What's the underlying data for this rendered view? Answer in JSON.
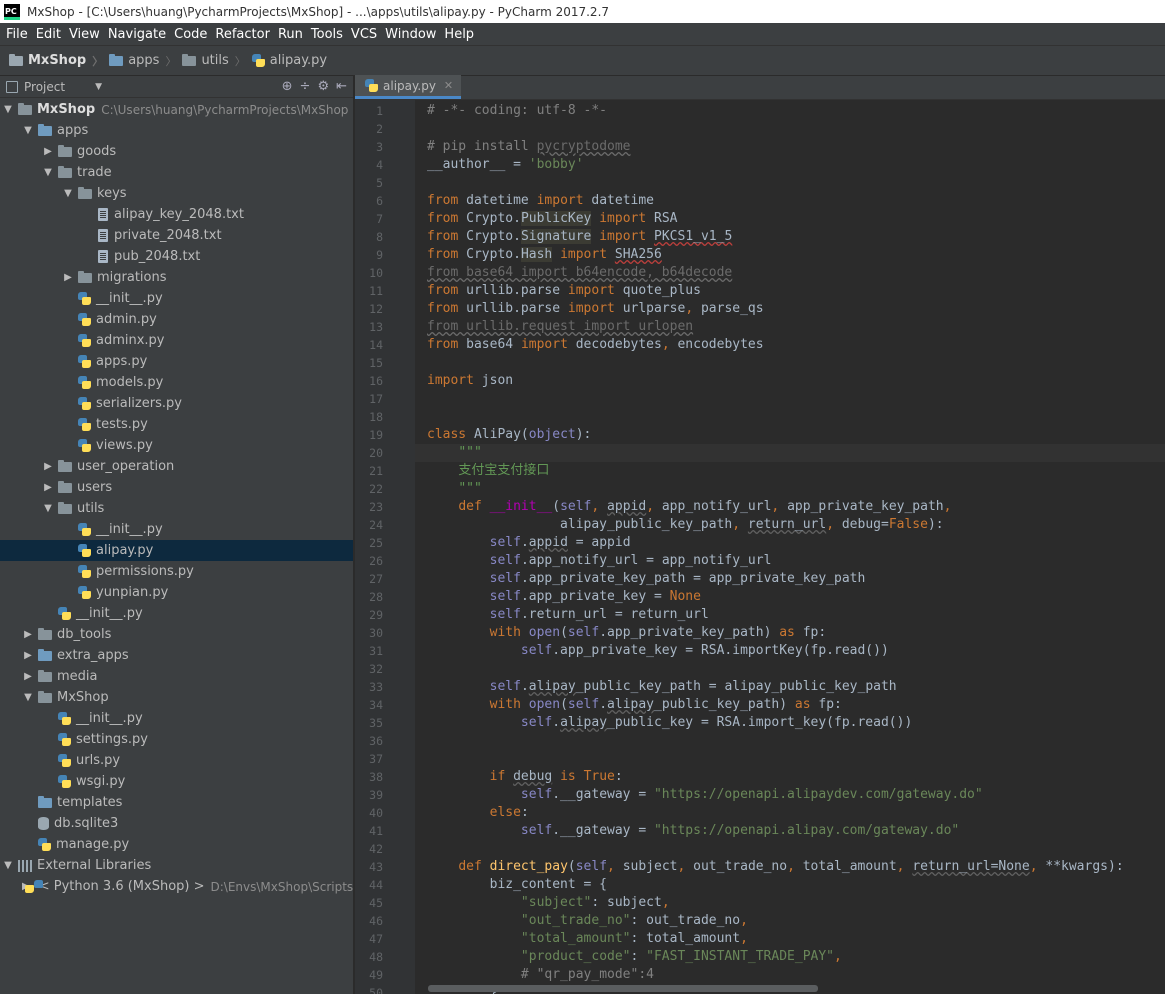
{
  "titlebar": {
    "icon_text": "PC",
    "title": "MxShop - [C:\\Users\\huang\\PycharmProjects\\MxShop] - ...\\apps\\utils\\alipay.py - PyCharm 2017.2.7"
  },
  "menu": [
    "File",
    "Edit",
    "View",
    "Navigate",
    "Code",
    "Refactor",
    "Run",
    "Tools",
    "VCS",
    "Window",
    "Help"
  ],
  "breadcrumb": [
    "MxShop",
    "apps",
    "utils",
    "alipay.py"
  ],
  "project_panel": {
    "label": "Project",
    "tools": [
      "⊕",
      "÷",
      "⚙",
      "⇤"
    ]
  },
  "tree": [
    {
      "label": "MxShop",
      "path": "C:\\Users\\huang\\PycharmProjects\\MxShop",
      "arrow": "▼",
      "icon": "folder",
      "indent": 0,
      "bold": true
    },
    {
      "label": "apps",
      "arrow": "▼",
      "icon": "folder-blue",
      "indent": 1
    },
    {
      "label": "goods",
      "arrow": "▶",
      "icon": "folder",
      "indent": 2
    },
    {
      "label": "trade",
      "arrow": "▼",
      "icon": "folder",
      "indent": 2
    },
    {
      "label": "keys",
      "arrow": "▼",
      "icon": "folder",
      "indent": 3
    },
    {
      "label": "alipay_key_2048.txt",
      "arrow": "",
      "icon": "file",
      "indent": 4
    },
    {
      "label": "private_2048.txt",
      "arrow": "",
      "icon": "file",
      "indent": 4
    },
    {
      "label": "pub_2048.txt",
      "arrow": "",
      "icon": "file",
      "indent": 4
    },
    {
      "label": "migrations",
      "arrow": "▶",
      "icon": "folder",
      "indent": 3
    },
    {
      "label": "__init__.py",
      "arrow": "",
      "icon": "py",
      "indent": 3
    },
    {
      "label": "admin.py",
      "arrow": "",
      "icon": "py",
      "indent": 3
    },
    {
      "label": "adminx.py",
      "arrow": "",
      "icon": "py",
      "indent": 3
    },
    {
      "label": "apps.py",
      "arrow": "",
      "icon": "py",
      "indent": 3
    },
    {
      "label": "models.py",
      "arrow": "",
      "icon": "py",
      "indent": 3
    },
    {
      "label": "serializers.py",
      "arrow": "",
      "icon": "py",
      "indent": 3
    },
    {
      "label": "tests.py",
      "arrow": "",
      "icon": "py",
      "indent": 3
    },
    {
      "label": "views.py",
      "arrow": "",
      "icon": "py",
      "indent": 3
    },
    {
      "label": "user_operation",
      "arrow": "▶",
      "icon": "folder",
      "indent": 2
    },
    {
      "label": "users",
      "arrow": "▶",
      "icon": "folder",
      "indent": 2
    },
    {
      "label": "utils",
      "arrow": "▼",
      "icon": "folder",
      "indent": 2
    },
    {
      "label": "__init__.py",
      "arrow": "",
      "icon": "py",
      "indent": 3
    },
    {
      "label": "alipay.py",
      "arrow": "",
      "icon": "py",
      "indent": 3,
      "selected": true
    },
    {
      "label": "permissions.py",
      "arrow": "",
      "icon": "py",
      "indent": 3
    },
    {
      "label": "yunpian.py",
      "arrow": "",
      "icon": "py",
      "indent": 3
    },
    {
      "label": "__init__.py",
      "arrow": "",
      "icon": "py",
      "indent": 2
    },
    {
      "label": "db_tools",
      "arrow": "▶",
      "icon": "folder",
      "indent": 1
    },
    {
      "label": "extra_apps",
      "arrow": "▶",
      "icon": "folder-blue",
      "indent": 1
    },
    {
      "label": "media",
      "arrow": "▶",
      "icon": "folder",
      "indent": 1
    },
    {
      "label": "MxShop",
      "arrow": "▼",
      "icon": "folder",
      "indent": 1
    },
    {
      "label": "__init__.py",
      "arrow": "",
      "icon": "py",
      "indent": 2
    },
    {
      "label": "settings.py",
      "arrow": "",
      "icon": "py",
      "indent": 2
    },
    {
      "label": "urls.py",
      "arrow": "",
      "icon": "py",
      "indent": 2
    },
    {
      "label": "wsgi.py",
      "arrow": "",
      "icon": "py",
      "indent": 2
    },
    {
      "label": "templates",
      "arrow": "",
      "icon": "folder-blue",
      "indent": 1
    },
    {
      "label": "db.sqlite3",
      "arrow": "",
      "icon": "db",
      "indent": 1
    },
    {
      "label": "manage.py",
      "arrow": "",
      "icon": "py",
      "indent": 1
    },
    {
      "label": "External Libraries",
      "arrow": "▼",
      "icon": "lib",
      "indent": 0
    },
    {
      "label": "< Python 3.6 (MxShop) >",
      "path": "D:\\Envs\\MxShop\\Scripts",
      "arrow": "▶",
      "icon": "py",
      "indent": 1
    }
  ],
  "editor": {
    "tab": "alipay.py",
    "tab_close": "✕",
    "current_line": 20,
    "lines": [
      [
        [
          "cm",
          "# -*- coding: utf-8 -*-"
        ]
      ],
      [],
      [
        [
          "cm",
          "# pip install "
        ],
        [
          "gr",
          "pycryptodome"
        ]
      ],
      [
        [
          "",
          "__author__ = "
        ],
        [
          "st",
          "'bobby'"
        ]
      ],
      [],
      [
        [
          "kw",
          "from "
        ],
        [
          "",
          "datetime "
        ],
        [
          "kw",
          "import "
        ],
        [
          "",
          "datetime"
        ]
      ],
      [
        [
          "kw",
          "from "
        ],
        [
          "",
          "Crypto."
        ],
        [
          "hl",
          "PublicKey"
        ],
        [
          "kw",
          " import "
        ],
        [
          "",
          "RSA"
        ]
      ],
      [
        [
          "kw",
          "from "
        ],
        [
          "",
          "Crypto."
        ],
        [
          "hl",
          "Signature"
        ],
        [
          "kw",
          " import "
        ],
        [
          "ur",
          "PKCS1_v1_5"
        ]
      ],
      [
        [
          "kw",
          "from "
        ],
        [
          "",
          "Crypto."
        ],
        [
          "hl",
          "Hash"
        ],
        [
          "kw",
          " import "
        ],
        [
          "ur",
          "SHA256"
        ]
      ],
      [
        [
          "gr",
          "from base64 import b64encode, b64decode"
        ]
      ],
      [
        [
          "kw",
          "from "
        ],
        [
          "",
          "urllib.parse "
        ],
        [
          "kw",
          "import "
        ],
        [
          "",
          "quote_plus"
        ]
      ],
      [
        [
          "kw",
          "from "
        ],
        [
          "",
          "urllib.parse "
        ],
        [
          "kw",
          "import "
        ],
        [
          "",
          "urlparse"
        ],
        [
          "kw",
          ", "
        ],
        [
          "",
          "parse_qs"
        ]
      ],
      [
        [
          "gr",
          "from urllib.request import urlopen"
        ]
      ],
      [
        [
          "kw",
          "from "
        ],
        [
          "",
          "base64 "
        ],
        [
          "kw",
          "import "
        ],
        [
          "",
          "decodebytes"
        ],
        [
          "kw",
          ", "
        ],
        [
          "",
          "encodebytes"
        ]
      ],
      [],
      [
        [
          "kw",
          "import "
        ],
        [
          "",
          "json"
        ]
      ],
      [],
      [],
      [
        [
          "kw",
          "class "
        ],
        [
          "",
          "AliPay("
        ],
        [
          "bi",
          "object"
        ],
        [
          "",
          "):"
        ]
      ],
      [
        [
          "",
          "    "
        ],
        [
          "cn",
          "\"\"\""
        ]
      ],
      [
        [
          "",
          "    "
        ],
        [
          "cn",
          "支付宝支付接口"
        ]
      ],
      [
        [
          "",
          "    "
        ],
        [
          "cn",
          "\"\"\""
        ]
      ],
      [
        [
          "",
          "    "
        ],
        [
          "kw",
          "def "
        ],
        [
          "dn",
          "__init__"
        ],
        [
          "",
          "("
        ],
        [
          "sf",
          "self"
        ],
        [
          "kw",
          ", "
        ],
        [
          "un",
          "appid"
        ],
        [
          "kw",
          ", "
        ],
        [
          "",
          "app_notify_url"
        ],
        [
          "kw",
          ", "
        ],
        [
          "",
          "app_private_key_path"
        ],
        [
          "kw",
          ","
        ]
      ],
      [
        [
          "",
          "                 alipay_public_key_path"
        ],
        [
          "kw",
          ", "
        ],
        [
          "un",
          "return_url"
        ],
        [
          "kw",
          ", "
        ],
        [
          "",
          "debug="
        ],
        [
          "kw",
          "False"
        ],
        [
          "",
          "):"
        ]
      ],
      [
        [
          "",
          "        "
        ],
        [
          "sf",
          "self"
        ],
        [
          "",
          "."
        ],
        [
          "un",
          "appid"
        ],
        [
          "",
          " = appid"
        ]
      ],
      [
        [
          "",
          "        "
        ],
        [
          "sf",
          "self"
        ],
        [
          "",
          ".app_notify_url = app_notify_url"
        ]
      ],
      [
        [
          "",
          "        "
        ],
        [
          "sf",
          "self"
        ],
        [
          "",
          ".app_private_key_path = app_private_key_path"
        ]
      ],
      [
        [
          "",
          "        "
        ],
        [
          "sf",
          "self"
        ],
        [
          "",
          ".app_private_key = "
        ],
        [
          "kw",
          "None"
        ]
      ],
      [
        [
          "",
          "        "
        ],
        [
          "sf",
          "self"
        ],
        [
          "",
          ".return_url = return_url"
        ]
      ],
      [
        [
          "",
          "        "
        ],
        [
          "kw",
          "with "
        ],
        [
          "bi",
          "open"
        ],
        [
          "",
          "("
        ],
        [
          "sf",
          "self"
        ],
        [
          "",
          ".app_private_key_path) "
        ],
        [
          "kw",
          "as "
        ],
        [
          "",
          "fp:"
        ]
      ],
      [
        [
          "",
          "            "
        ],
        [
          "sf",
          "self"
        ],
        [
          "",
          ".app_private_key = RSA.importKey(fp.read())"
        ]
      ],
      [],
      [
        [
          "",
          "        "
        ],
        [
          "sf",
          "self"
        ],
        [
          "",
          "."
        ],
        [
          "un",
          "alipay"
        ],
        [
          "",
          "_public_key_path = alipay_public_key_path"
        ]
      ],
      [
        [
          "",
          "        "
        ],
        [
          "kw",
          "with "
        ],
        [
          "bi",
          "open"
        ],
        [
          "",
          "("
        ],
        [
          "sf",
          "self"
        ],
        [
          "",
          "."
        ],
        [
          "un",
          "alipay"
        ],
        [
          "",
          "_public_key_path) "
        ],
        [
          "kw",
          "as "
        ],
        [
          "",
          "fp:"
        ]
      ],
      [
        [
          "",
          "            "
        ],
        [
          "sf",
          "self"
        ],
        [
          "",
          "."
        ],
        [
          "un",
          "alipay"
        ],
        [
          "",
          "_public_key = RSA.import_key(fp.read())"
        ]
      ],
      [],
      [],
      [
        [
          "",
          "        "
        ],
        [
          "kw",
          "if "
        ],
        [
          "un",
          "debug"
        ],
        [
          "kw",
          " is "
        ],
        [
          "kw",
          "True"
        ],
        [
          "",
          ":"
        ]
      ],
      [
        [
          "",
          "            "
        ],
        [
          "sf",
          "self"
        ],
        [
          "",
          ".__gateway = "
        ],
        [
          "st",
          "\"https://openapi.alipaydev.com/gateway.do\""
        ]
      ],
      [
        [
          "",
          "        "
        ],
        [
          "kw",
          "else"
        ],
        [
          "",
          ":"
        ]
      ],
      [
        [
          "",
          "            "
        ],
        [
          "sf",
          "self"
        ],
        [
          "",
          ".__gateway = "
        ],
        [
          "st",
          "\"https://openapi.alipay.com/gateway.do\""
        ]
      ],
      [],
      [
        [
          "",
          "    "
        ],
        [
          "kw",
          "def "
        ],
        [
          "fn",
          "direct_pay"
        ],
        [
          "",
          "("
        ],
        [
          "sf",
          "self"
        ],
        [
          "kw",
          ", "
        ],
        [
          "",
          "subject"
        ],
        [
          "kw",
          ", "
        ],
        [
          "",
          "out_trade_no"
        ],
        [
          "kw",
          ", "
        ],
        [
          "",
          "total_amount"
        ],
        [
          "kw",
          ", "
        ],
        [
          "un",
          "return_url=None"
        ],
        [
          "kw",
          ", "
        ],
        [
          "",
          "**kwargs):"
        ]
      ],
      [
        [
          "",
          "        biz_content = {"
        ]
      ],
      [
        [
          "",
          "            "
        ],
        [
          "st",
          "\"subject\""
        ],
        [
          "",
          ": subject"
        ],
        [
          "kw",
          ","
        ]
      ],
      [
        [
          "",
          "            "
        ],
        [
          "st",
          "\"out_trade_no\""
        ],
        [
          "",
          ": out_trade_no"
        ],
        [
          "kw",
          ","
        ]
      ],
      [
        [
          "",
          "            "
        ],
        [
          "st",
          "\"total_amount\""
        ],
        [
          "",
          ": total_amount"
        ],
        [
          "kw",
          ","
        ]
      ],
      [
        [
          "",
          "            "
        ],
        [
          "st",
          "\"product_code\""
        ],
        [
          "",
          ": "
        ],
        [
          "st",
          "\"FAST_INSTANT_TRADE_PAY\""
        ],
        [
          "kw",
          ","
        ]
      ],
      [
        [
          "",
          "            "
        ],
        [
          "cm",
          "# \"qr_pay_mode\":4"
        ]
      ],
      [
        [
          "",
          "        }"
        ]
      ]
    ]
  }
}
